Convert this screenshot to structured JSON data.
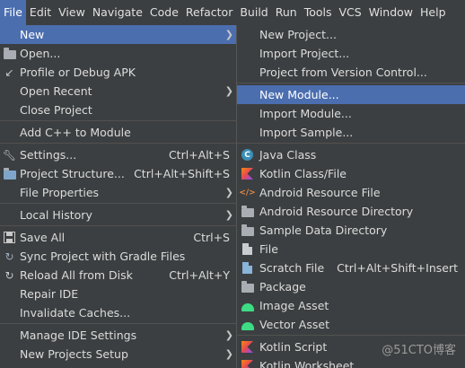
{
  "menubar": {
    "items": [
      "File",
      "Edit",
      "View",
      "Navigate",
      "Code",
      "Refactor",
      "Build",
      "Run",
      "Tools",
      "VCS",
      "Window",
      "Help"
    ]
  },
  "file_menu": {
    "new": "New",
    "open": "Open...",
    "profile": "Profile or Debug APK",
    "open_recent": "Open Recent",
    "close_project": "Close Project",
    "add_cpp": "Add C++ to Module",
    "settings": "Settings...",
    "settings_sc": "Ctrl+Alt+S",
    "project_structure": "Project Structure...",
    "project_structure_sc": "Ctrl+Alt+Shift+S",
    "file_properties": "File Properties",
    "local_history": "Local History",
    "save_all": "Save All",
    "save_all_sc": "Ctrl+S",
    "sync_gradle": "Sync Project with Gradle Files",
    "reload_disk": "Reload All from Disk",
    "reload_disk_sc": "Ctrl+Alt+Y",
    "repair_ide": "Repair IDE",
    "invalidate_caches": "Invalidate Caches...",
    "manage_ide": "Manage IDE Settings",
    "new_projects_setup": "New Projects Setup"
  },
  "new_submenu": {
    "new_project": "New Project...",
    "import_project": "Import Project...",
    "project_vcs": "Project from Version Control...",
    "new_module": "New Module...",
    "import_module": "Import Module...",
    "import_sample": "Import Sample...",
    "java_class": "Java Class",
    "kotlin_class": "Kotlin Class/File",
    "android_resource_file": "Android Resource File",
    "android_resource_dir": "Android Resource Directory",
    "sample_data_dir": "Sample Data Directory",
    "file": "File",
    "scratch_file": "Scratch File",
    "scratch_file_sc": "Ctrl+Alt+Shift+Insert",
    "package": "Package",
    "image_asset": "Image Asset",
    "vector_asset": "Vector Asset",
    "kotlin_script": "Kotlin Script",
    "kotlin_worksheet": "Kotlin Worksheet"
  },
  "watermark": "@51CTO博客",
  "colors": {
    "background": "#3c3f41",
    "selection": "#4b6eaf"
  }
}
